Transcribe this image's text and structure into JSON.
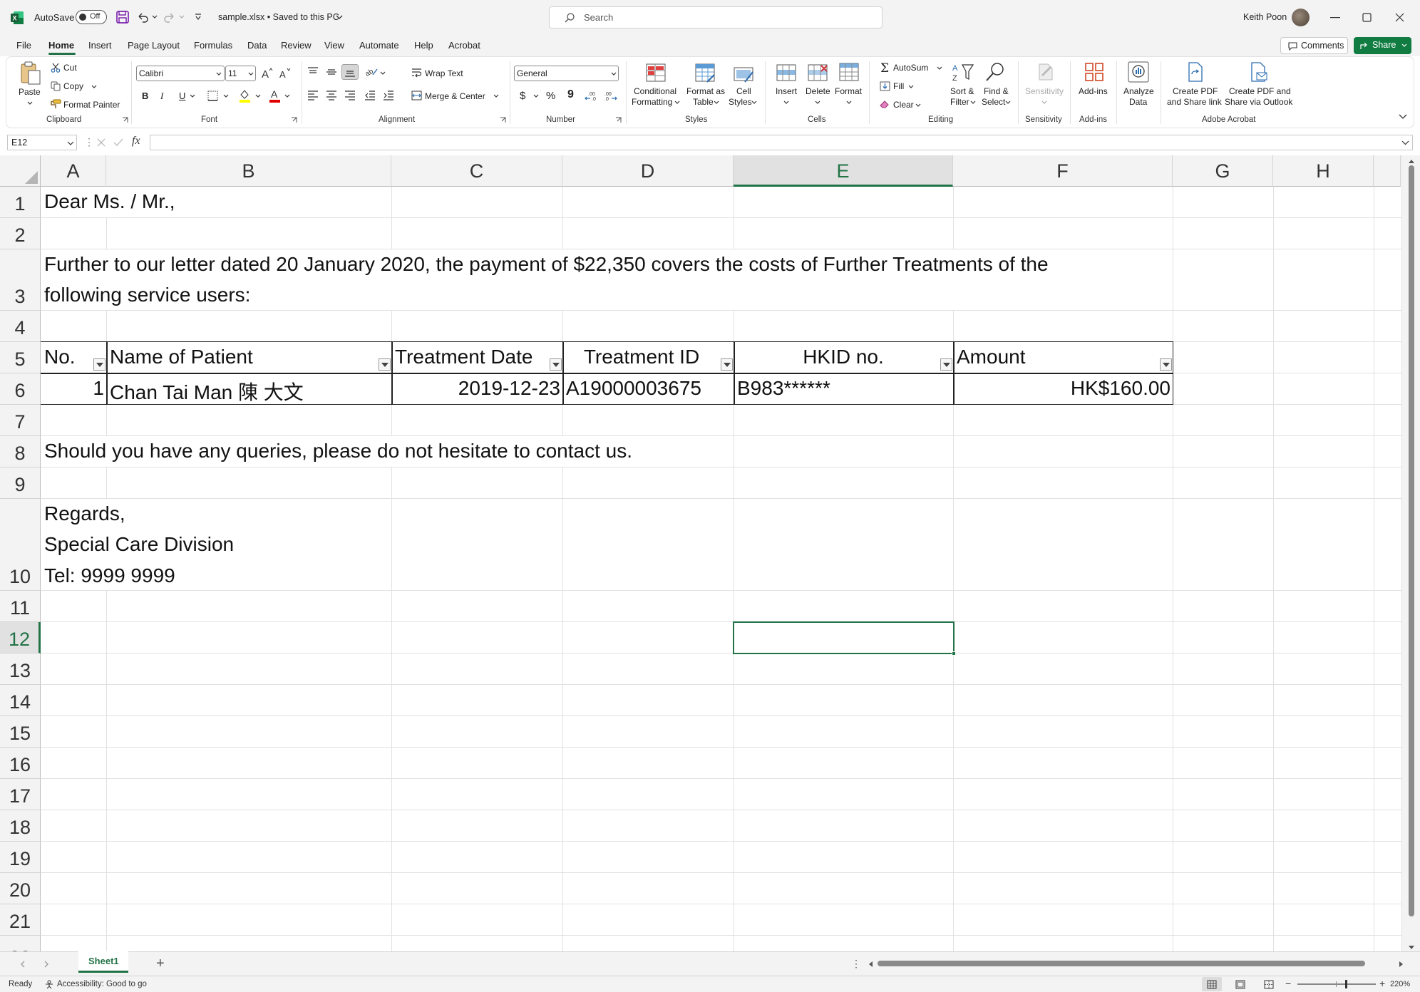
{
  "titlebar": {
    "autosave_label": "AutoSave",
    "autosave_state": "Off",
    "file_title": "sample.xlsx • Saved to this PC",
    "search_placeholder": "Search",
    "user_name": "Keith Poon"
  },
  "menu": {
    "items": [
      "File",
      "Home",
      "Insert",
      "Page Layout",
      "Formulas",
      "Data",
      "Review",
      "View",
      "Automate",
      "Help",
      "Acrobat"
    ],
    "active": "Home",
    "comments_label": "Comments",
    "share_label": "Share"
  },
  "ribbon": {
    "clipboard": {
      "paste": "Paste",
      "cut": "Cut",
      "copy": "Copy",
      "format_painter": "Format Painter",
      "label": "Clipboard"
    },
    "font": {
      "name": "Calibri",
      "size": "11",
      "label": "Font",
      "bold": "B",
      "italic": "I",
      "underline": "U"
    },
    "alignment": {
      "wrap_text": "Wrap Text",
      "merge_center": "Merge & Center",
      "label": "Alignment"
    },
    "number": {
      "format": "General",
      "label": "Number",
      "currency": "$",
      "percent": "%",
      "comma": "9"
    },
    "styles": {
      "conditional_1": "Conditional",
      "conditional_2": "Formatting",
      "format_table_1": "Format as",
      "format_table_2": "Table",
      "cell_styles_1": "Cell",
      "cell_styles_2": "Styles",
      "label": "Styles"
    },
    "cells": {
      "insert": "Insert",
      "delete": "Delete",
      "format": "Format",
      "label": "Cells"
    },
    "editing": {
      "autosum": "AutoSum",
      "fill": "Fill",
      "clear": "Clear",
      "sort_1": "Sort &",
      "sort_2": "Filter",
      "find_1": "Find &",
      "find_2": "Select",
      "label": "Editing"
    },
    "sensitivity": {
      "button": "Sensitivity",
      "label": "Sensitivity"
    },
    "addins": {
      "button": "Add-ins",
      "label": "Add-ins"
    },
    "analyze": {
      "button_1": "Analyze",
      "button_2": "Data"
    },
    "acrobat": {
      "create_1": "Create PDF",
      "create_2": "and Share link",
      "share_1": "Create PDF and",
      "share_2": "Share via Outlook",
      "label": "Adobe Acrobat"
    }
  },
  "formula_bar": {
    "name_box": "E12",
    "fx": "fx",
    "formula": ""
  },
  "columns": [
    "A",
    "B",
    "C",
    "D",
    "E",
    "F",
    "G",
    "H"
  ],
  "selected_column": "E",
  "rows": [
    "1",
    "2",
    "3",
    "4",
    "5",
    "6",
    "7",
    "8",
    "9",
    "10",
    "11",
    "12",
    "13",
    "14",
    "15",
    "16",
    "17",
    "18",
    "19",
    "20",
    "21",
    "22"
  ],
  "selected_row": "12",
  "cells": {
    "a1": "Dear Ms. / Mr.,",
    "a3_line1": "Further to our letter dated 20 January 2020, the payment of $22,350 covers the costs of Further Treatments of the",
    "a3_line2": "following service users:",
    "table_headers": [
      "No.",
      "Name of Patient",
      "Treatment Date",
      "Treatment ID",
      "HKID no.",
      "Amount"
    ],
    "row6": [
      "1",
      "Chan Tai Man 陳 大文",
      "2019-12-23",
      "A19000003675",
      "B983******",
      "HK$160.00"
    ],
    "a8": "Should you have any queries, please do not hesitate to contact us.",
    "a10_line1": "Regards,",
    "a10_line2": "Special Care Division",
    "a10_line3": "Tel: 9999 9999"
  },
  "sheet_tabs": {
    "active": "Sheet1",
    "add": "+"
  },
  "status": {
    "ready": "Ready",
    "accessibility": "Accessibility: Good to go",
    "zoom": "220%"
  }
}
